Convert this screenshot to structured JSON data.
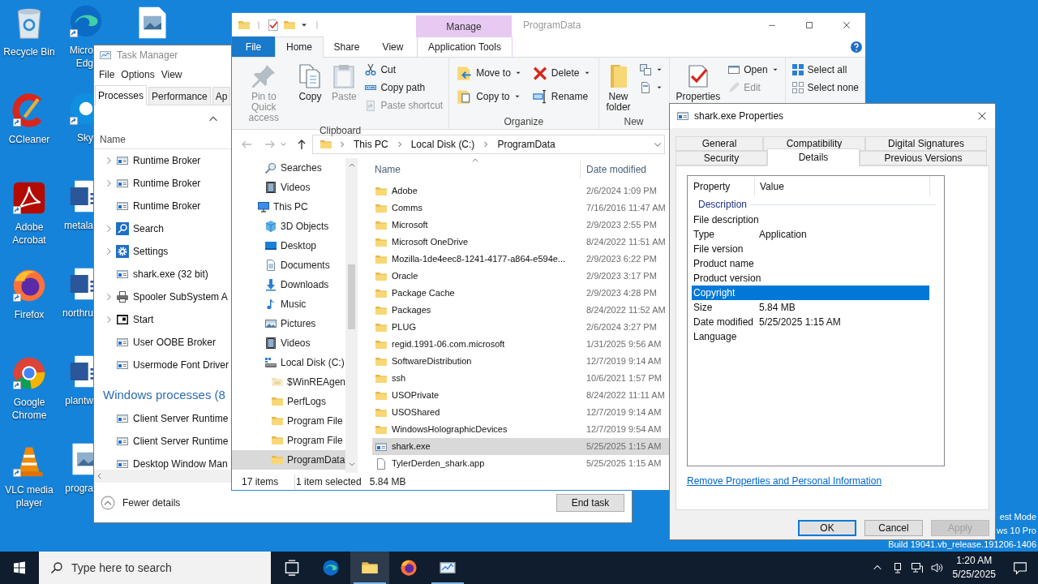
{
  "desktop": {
    "columns": [
      [
        {
          "label": "Recycle Bin",
          "kind": "recycle-bin",
          "shortcut": false
        },
        {
          "label": "CCleaner",
          "kind": "ccleaner",
          "shortcut": true
        },
        {
          "label": "Adobe\nAcrobat",
          "kind": "acrobat",
          "shortcut": true
        },
        {
          "label": "Firefox",
          "kind": "firefox",
          "shortcut": true
        },
        {
          "label": "Google\nChrome",
          "kind": "chrome",
          "shortcut": true
        },
        {
          "label": "VLC media\nplayer",
          "kind": "vlc",
          "shortcut": true
        }
      ],
      [
        {
          "label": "Micro\nEdg",
          "kind": "edge",
          "shortcut": true
        },
        {
          "label": "Sky",
          "kind": "skype",
          "shortcut": true
        },
        {
          "label": "metala",
          "kind": "word-doc",
          "shortcut": false
        },
        {
          "label": "northru",
          "kind": "word-doc",
          "shortcut": false
        },
        {
          "label": "plantw",
          "kind": "word-doc",
          "shortcut": false
        },
        {
          "label": "progra",
          "kind": "image-file",
          "shortcut": false
        }
      ],
      [
        {
          "kind": "image-file",
          "shortcut": false
        }
      ]
    ],
    "os_notice": [
      "est Mode",
      "ws 10 Pro",
      "Build 19041.vb_release.191206-1406"
    ]
  },
  "task_manager": {
    "title": "Task Manager",
    "menu": [
      "File",
      "Options",
      "View"
    ],
    "tabs": [
      {
        "label": "Processes",
        "selected": true
      },
      {
        "label": "Performance",
        "selected": false
      },
      {
        "label": "Ap",
        "selected": false
      }
    ],
    "column_header": "Name",
    "rows": [
      {
        "kind": "app",
        "name": "Runtime Broker",
        "expandable": true
      },
      {
        "kind": "app",
        "name": "Runtime Broker",
        "expandable": true
      },
      {
        "kind": "app",
        "name": "Runtime Broker",
        "expandable": false
      },
      {
        "kind": "search",
        "name": "Search",
        "expandable": true
      },
      {
        "kind": "settings",
        "name": "Settings",
        "expandable": true
      },
      {
        "kind": "app",
        "name": "shark.exe (32 bit)",
        "expandable": false
      },
      {
        "kind": "printer",
        "name": "Spooler SubSystem A",
        "expandable": true
      },
      {
        "kind": "start",
        "name": "Start",
        "expandable": true
      },
      {
        "kind": "app",
        "name": "User OOBE Broker",
        "expandable": false
      },
      {
        "kind": "app",
        "name": "Usermode Font Driver",
        "expandable": false
      },
      {
        "kind": "group",
        "name": "Windows processes (8"
      },
      {
        "kind": "app",
        "name": "Client Server Runtime",
        "expandable": false
      },
      {
        "kind": "app",
        "name": "Client Server Runtime",
        "expandable": false
      },
      {
        "kind": "app",
        "name": "Desktop Window Man",
        "expandable": false
      }
    ],
    "footer_link": "Fewer details",
    "end_task": "End task"
  },
  "explorer": {
    "title": "ProgramData",
    "contextual_group": "Manage",
    "tabs": [
      {
        "label": "File",
        "kind": "file",
        "selected": false
      },
      {
        "label": "Home",
        "kind": "tab",
        "selected": true
      },
      {
        "label": "Share",
        "kind": "tab",
        "selected": false
      },
      {
        "label": "View",
        "kind": "tab",
        "selected": false
      },
      {
        "label": "Application Tools",
        "kind": "contextual",
        "selected": false
      }
    ],
    "ribbon": [
      {
        "label": "Clipboard",
        "items": [
          {
            "kind": "large",
            "label": "Pin to Quick\naccess",
            "disabled": true
          },
          {
            "kind": "large",
            "label": "Copy",
            "disabled": false
          },
          {
            "kind": "large",
            "label": "Paste",
            "disabled": true
          },
          {
            "kind": "stack",
            "items": [
              {
                "label": "Cut",
                "disabled": false,
                "dropdown": false
              },
              {
                "label": "Copy path",
                "disabled": false,
                "dropdown": false
              },
              {
                "label": "Paste shortcut",
                "disabled": true,
                "dropdown": false
              }
            ]
          }
        ]
      },
      {
        "label": "Organize",
        "items": [
          {
            "kind": "medium",
            "items": [
              {
                "label": "Move to",
                "disabled": false,
                "dropdown": true
              },
              {
                "label": "Copy to",
                "disabled": false,
                "dropdown": true
              }
            ]
          },
          {
            "kind": "medium",
            "items": [
              {
                "label": "Delete",
                "disabled": false,
                "dropdown": true
              },
              {
                "label": "Rename",
                "disabled": false,
                "dropdown": false
              }
            ]
          }
        ]
      },
      {
        "label": "New",
        "items": [
          {
            "kind": "large",
            "label": "New\nfolder",
            "disabled": false
          },
          {
            "kind": "stack",
            "items": [
              {
                "disabled": false,
                "dropdown": true
              },
              {
                "disabled": false,
                "dropdown": true
              }
            ]
          }
        ]
      },
      {
        "items": [
          {
            "kind": "large",
            "label": "Properties",
            "disabled": false
          },
          {
            "kind": "stack",
            "items": [
              {
                "label": "Open",
                "disabled": false,
                "dropdown": true
              },
              {
                "label": "Edit",
                "disabled": true,
                "dropdown": false
              }
            ]
          }
        ]
      },
      {
        "items": [
          {
            "kind": "stack",
            "items": [
              {
                "label": "Select all",
                "disabled": false,
                "dropdown": false
              },
              {
                "label": "Select none",
                "disabled": false,
                "dropdown": false
              }
            ]
          }
        ]
      }
    ],
    "breadcrumbs": [
      "This PC",
      "Local Disk (C:)",
      "ProgramData"
    ],
    "nav": {
      "continued": [
        {
          "label": "Searches",
          "kind": "search-folder",
          "selected": false
        },
        {
          "label": "Videos",
          "kind": "video",
          "selected": false
        }
      ],
      "tree": [
        {
          "label": "This PC",
          "kind": "pc",
          "selected": false,
          "children": [
            {
              "label": "3D Objects",
              "kind": "cube",
              "selected": false
            },
            {
              "label": "Desktop",
              "kind": "desktop",
              "selected": false
            },
            {
              "label": "Documents",
              "kind": "documents",
              "selected": false
            },
            {
              "label": "Downloads",
              "kind": "downloads",
              "selected": false
            },
            {
              "label": "Music",
              "kind": "music",
              "selected": false
            },
            {
              "label": "Pictures",
              "kind": "pictures",
              "selected": false
            },
            {
              "label": "Videos",
              "kind": "video",
              "selected": false
            },
            {
              "label": "Local Disk (C:)",
              "kind": "disk",
              "selected": false,
              "children": [
                {
                  "label": "$WinREAgen",
                  "kind": "folder-pale",
                  "selected": false
                },
                {
                  "label": "PerfLogs",
                  "kind": "folder",
                  "selected": false
                },
                {
                  "label": "Program File",
                  "kind": "folder",
                  "selected": false
                },
                {
                  "label": "Program File",
                  "kind": "folder",
                  "selected": false
                },
                {
                  "label": "ProgramData",
                  "kind": "folder",
                  "selected": true
                }
              ]
            }
          ]
        }
      ]
    },
    "columns": [
      "Name",
      "Date modified"
    ],
    "files": [
      {
        "name": "Adobe",
        "date": "2/6/2024 1:09 PM",
        "kind": "folder",
        "selected": false
      },
      {
        "name": "Comms",
        "date": "7/16/2016 11:47 AM",
        "kind": "folder",
        "selected": false
      },
      {
        "name": "Microsoft",
        "date": "2/9/2023 2:55 PM",
        "kind": "folder",
        "selected": false
      },
      {
        "name": "Microsoft OneDrive",
        "date": "8/24/2022 11:51 AM",
        "kind": "folder",
        "selected": false
      },
      {
        "name": "Mozilla-1de4eec8-1241-4177-a864-e594e...",
        "date": "2/9/2023 6:22 PM",
        "kind": "folder",
        "selected": false
      },
      {
        "name": "Oracle",
        "date": "2/9/2023 3:17 PM",
        "kind": "folder",
        "selected": false
      },
      {
        "name": "Package Cache",
        "date": "2/9/2023 4:28 PM",
        "kind": "folder",
        "selected": false
      },
      {
        "name": "Packages",
        "date": "8/24/2022 11:52 AM",
        "kind": "folder",
        "selected": false
      },
      {
        "name": "PLUG",
        "date": "2/6/2024 3:27 PM",
        "kind": "folder",
        "selected": false
      },
      {
        "name": "regid.1991-06.com.microsoft",
        "date": "1/31/2025 9:56 AM",
        "kind": "folder",
        "selected": false
      },
      {
        "name": "SoftwareDistribution",
        "date": "12/7/2019 9:14 AM",
        "kind": "folder",
        "selected": false
      },
      {
        "name": "ssh",
        "date": "10/6/2021 1:57 PM",
        "kind": "folder",
        "selected": false
      },
      {
        "name": "USOPrivate",
        "date": "8/24/2022 11:11 AM",
        "kind": "folder",
        "selected": false
      },
      {
        "name": "USOShared",
        "date": "12/7/2019 9:14 AM",
        "kind": "folder",
        "selected": false
      },
      {
        "name": "WindowsHolographicDevices",
        "date": "12/7/2019 9:54 AM",
        "kind": "folder",
        "selected": false
      },
      {
        "name": "shark.exe",
        "date": "5/25/2025 1:15 AM",
        "kind": "app",
        "selected": true
      },
      {
        "name": "TylerDerden_shark.app",
        "date": "5/25/2025 1:15 AM",
        "kind": "file",
        "selected": false
      }
    ],
    "status": {
      "count": "17 items",
      "selection": "1 item selected",
      "size": "5.84 MB"
    }
  },
  "properties_dialog": {
    "title": "shark.exe Properties",
    "tab_rows": [
      [
        {
          "label": "General",
          "selected": false
        },
        {
          "label": "Compatibility",
          "selected": false
        },
        {
          "label": "Digital Signatures",
          "selected": false
        }
      ],
      [
        {
          "label": "Security",
          "selected": false
        },
        {
          "label": "Details",
          "selected": true
        },
        {
          "label": "Previous Versions",
          "selected": false
        }
      ]
    ],
    "columns": [
      "Property",
      "Value"
    ],
    "section": "Description",
    "rows": [
      {
        "property": "File description",
        "selected": false
      },
      {
        "property": "Type",
        "value": "Application",
        "selected": false
      },
      {
        "property": "File version",
        "selected": false
      },
      {
        "property": "Product name",
        "selected": false
      },
      {
        "property": "Product version",
        "selected": false
      },
      {
        "property": "Copyright",
        "selected": true
      },
      {
        "property": "Size",
        "value": "5.84 MB",
        "selected": false
      },
      {
        "property": "Date modified",
        "value": "5/25/2025 1:15 AM",
        "selected": false
      },
      {
        "property": "Language",
        "selected": false
      }
    ],
    "link": "Remove Properties and Personal Information",
    "buttons": [
      {
        "label": "OK",
        "default": true,
        "disabled": false
      },
      {
        "label": "Cancel",
        "default": false,
        "disabled": false
      },
      {
        "label": "Apply",
        "default": false,
        "disabled": true
      }
    ]
  },
  "taskbar": {
    "search_placeholder": "Type here to search",
    "apps": [
      {
        "kind": "task-view",
        "active": false,
        "running": false
      },
      {
        "kind": "edge",
        "active": false,
        "running": false
      },
      {
        "kind": "folder",
        "active": true,
        "running": true
      },
      {
        "kind": "firefox",
        "active": false,
        "running": false
      },
      {
        "kind": "tm-app",
        "active": false,
        "running": true
      }
    ],
    "time": "1:20 AM",
    "date": "5/25/2025"
  }
}
